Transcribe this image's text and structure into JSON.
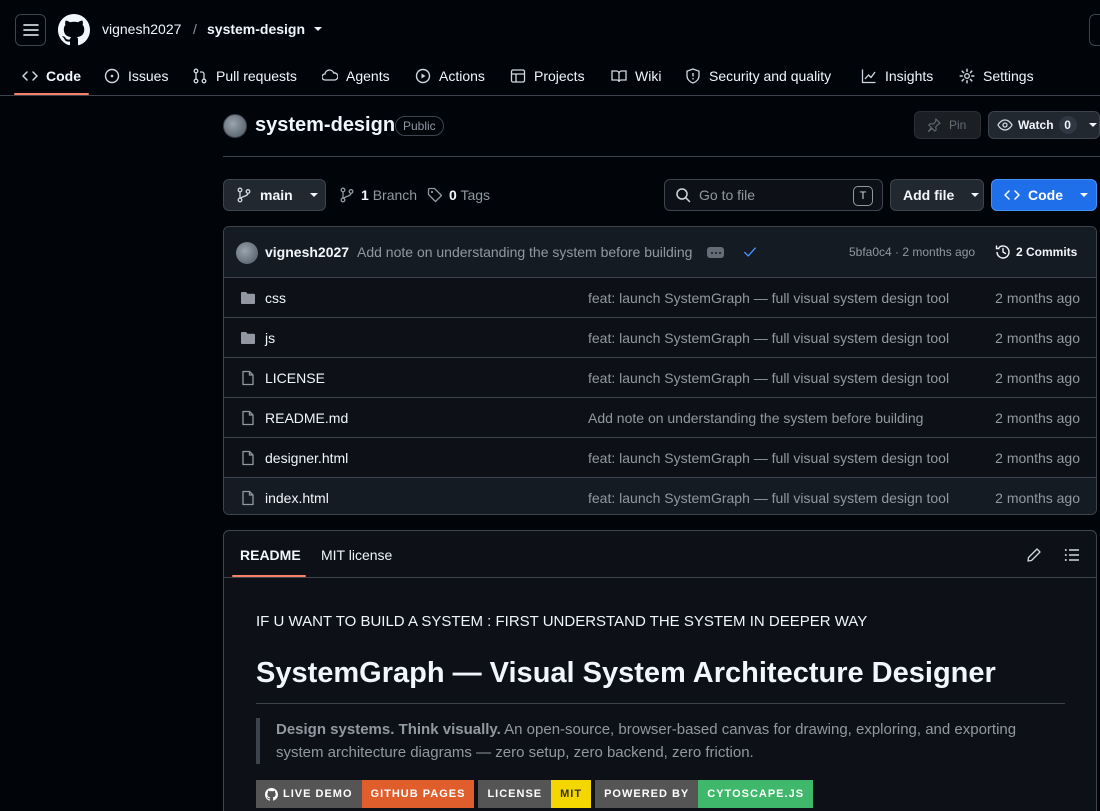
{
  "header": {
    "owner": "vignesh2027",
    "separator": "/",
    "repo": "system-design"
  },
  "nav": {
    "tabs": [
      {
        "label": "Code",
        "icon": "code-icon",
        "active": true
      },
      {
        "label": "Issues",
        "icon": "issue-icon"
      },
      {
        "label": "Pull requests",
        "icon": "pull-request-icon"
      },
      {
        "label": "Agents",
        "icon": "agents-icon"
      },
      {
        "label": "Actions",
        "icon": "play-icon"
      },
      {
        "label": "Projects",
        "icon": "table-icon"
      },
      {
        "label": "Wiki",
        "icon": "book-icon"
      },
      {
        "label": "Security and quality",
        "icon": "shield-icon"
      },
      {
        "label": "Insights",
        "icon": "graph-icon"
      },
      {
        "label": "Settings",
        "icon": "gear-icon"
      }
    ]
  },
  "repo": {
    "name": "system-design",
    "visibility": "Public",
    "pin_label": "Pin",
    "watch_label": "Watch",
    "watch_count": "0"
  },
  "toolbar": {
    "branch": "main",
    "branch_count": "1",
    "branch_label": "Branch",
    "tag_count": "0",
    "tag_label": "Tags",
    "goto_placeholder": "Go to file",
    "goto_key": "T",
    "add_file_label": "Add file",
    "code_label": "Code"
  },
  "latest_commit": {
    "author": "vignesh2027",
    "message": "Add note on understanding the system before building",
    "hash_time": "5bfa0c4 · 2 months ago",
    "commits_label": "2 Commits"
  },
  "files": [
    {
      "type": "dir",
      "name": "css",
      "message": "feat: launch SystemGraph — full visual system design tool",
      "date": "2 months ago"
    },
    {
      "type": "dir",
      "name": "js",
      "message": "feat: launch SystemGraph — full visual system design tool",
      "date": "2 months ago"
    },
    {
      "type": "file",
      "name": "LICENSE",
      "message": "feat: launch SystemGraph — full visual system design tool",
      "date": "2 months ago"
    },
    {
      "type": "file",
      "name": "README.md",
      "message": "Add note on understanding the system before building",
      "date": "2 months ago"
    },
    {
      "type": "file",
      "name": "designer.html",
      "message": "feat: launch SystemGraph — full visual system design tool",
      "date": "2 months ago"
    },
    {
      "type": "file",
      "name": "index.html",
      "message": "feat: launch SystemGraph — full visual system design tool",
      "date": "2 months ago"
    }
  ],
  "readme": {
    "tab_readme": "README",
    "tab_license": "MIT license",
    "note": "IF U WANT TO BUILD A SYSTEM : FIRST UNDERSTAND THE SYSTEM IN DEEPER WAY",
    "title": "SystemGraph — Visual System Architecture Designer",
    "quote_bold": "Design systems. Think visually.",
    "quote_line1": " An open-source, browser-based canvas for drawing, exploring, and exporting",
    "quote_line2": "system architecture diagrams — zero setup, zero backend, zero friction.",
    "badges": [
      {
        "left": "LIVE DEMO",
        "right": "GITHUB PAGES",
        "color": "#e05d2c",
        "icon": true
      },
      {
        "left": "LICENSE",
        "right": "MIT",
        "color": "#f4d600",
        "dark_text": true
      },
      {
        "left": "POWERED BY",
        "right": "CYTOSCAPE.JS",
        "color": "#3fb86b"
      }
    ]
  },
  "colors": {
    "accent_underline": "#f78166",
    "primary_button": "#1f6feb",
    "check": "#4493f8"
  }
}
